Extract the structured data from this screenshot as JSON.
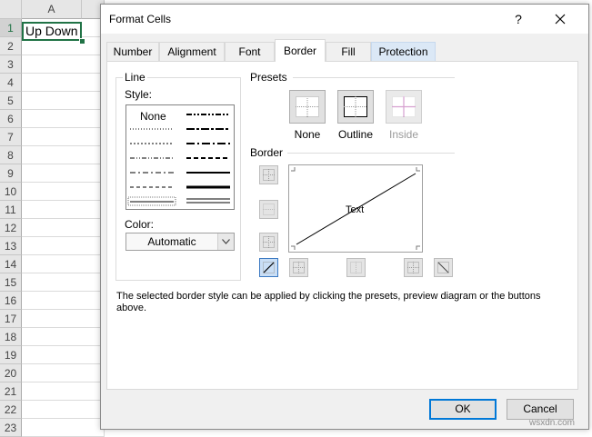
{
  "sheet": {
    "column_headers": [
      "A"
    ],
    "row_numbers": [
      "1",
      "2",
      "3",
      "4",
      "5",
      "6",
      "7",
      "8",
      "9",
      "10",
      "11",
      "12",
      "13",
      "14",
      "15",
      "16",
      "17",
      "18",
      "19",
      "20",
      "21",
      "22",
      "23"
    ],
    "active_cell_value": "Up Down",
    "accent_color": "#217346"
  },
  "dialog": {
    "title": "Format Cells",
    "help_label": "?",
    "tabs": [
      {
        "label": "Number"
      },
      {
        "label": "Alignment"
      },
      {
        "label": "Font"
      },
      {
        "label": "Border"
      },
      {
        "label": "Fill"
      },
      {
        "label": "Protection"
      }
    ],
    "active_tab": "Border",
    "line_group": {
      "label": "Line",
      "style_label": "Style:",
      "style_none": "None",
      "color_label": "Color:",
      "color_value": "Automatic"
    },
    "presets": {
      "label": "Presets",
      "items": [
        {
          "label": "None",
          "enabled": true
        },
        {
          "label": "Outline",
          "enabled": true
        },
        {
          "label": "Inside",
          "enabled": false
        }
      ]
    },
    "border": {
      "label": "Border",
      "preview_text": "Text",
      "active_button": "diagonal-up"
    },
    "description": "The selected border style can be applied by clicking the presets, preview diagram or the buttons above.",
    "ok_label": "OK",
    "cancel_label": "Cancel"
  },
  "watermark": "wsxdn.com"
}
